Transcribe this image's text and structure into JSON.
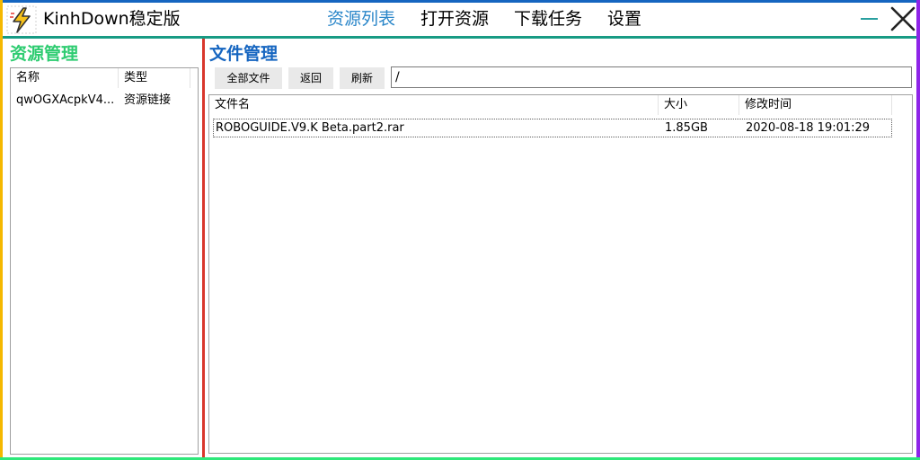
{
  "app": {
    "title": "KinhDown稳定版",
    "icon": "lightning-bolt-icon"
  },
  "nav": {
    "items": [
      {
        "label": "资源列表",
        "active": true
      },
      {
        "label": "打开资源",
        "active": false
      },
      {
        "label": "下载任务",
        "active": false
      },
      {
        "label": "设置",
        "active": false
      }
    ]
  },
  "left": {
    "title": "资源管理",
    "columns": [
      "名称",
      "类型"
    ],
    "rows": [
      {
        "name": "qwOGXAcpkV4...",
        "type": "资源链接"
      }
    ]
  },
  "right": {
    "title": "文件管理",
    "toolbar": {
      "all_files": "全部文件",
      "back": "返回",
      "refresh": "刷新"
    },
    "path": "/",
    "columns": [
      "文件名",
      "大小",
      "修改时间"
    ],
    "files": [
      {
        "name": "ROBOGUIDE.V9.K Beta.part2.rar",
        "size": "1.85GB",
        "modified": "2020-08-18 19:01:29"
      }
    ]
  },
  "colors": {
    "nav_active": "#2a86c9",
    "left_title": "#2ecc71",
    "right_title": "#1565c0",
    "top_edge": "#1565c0",
    "left_edge": "#f5b800",
    "right_edge": "#8e24e8",
    "bottom_edge": "#2ee87a",
    "divider": "#d9372c"
  }
}
